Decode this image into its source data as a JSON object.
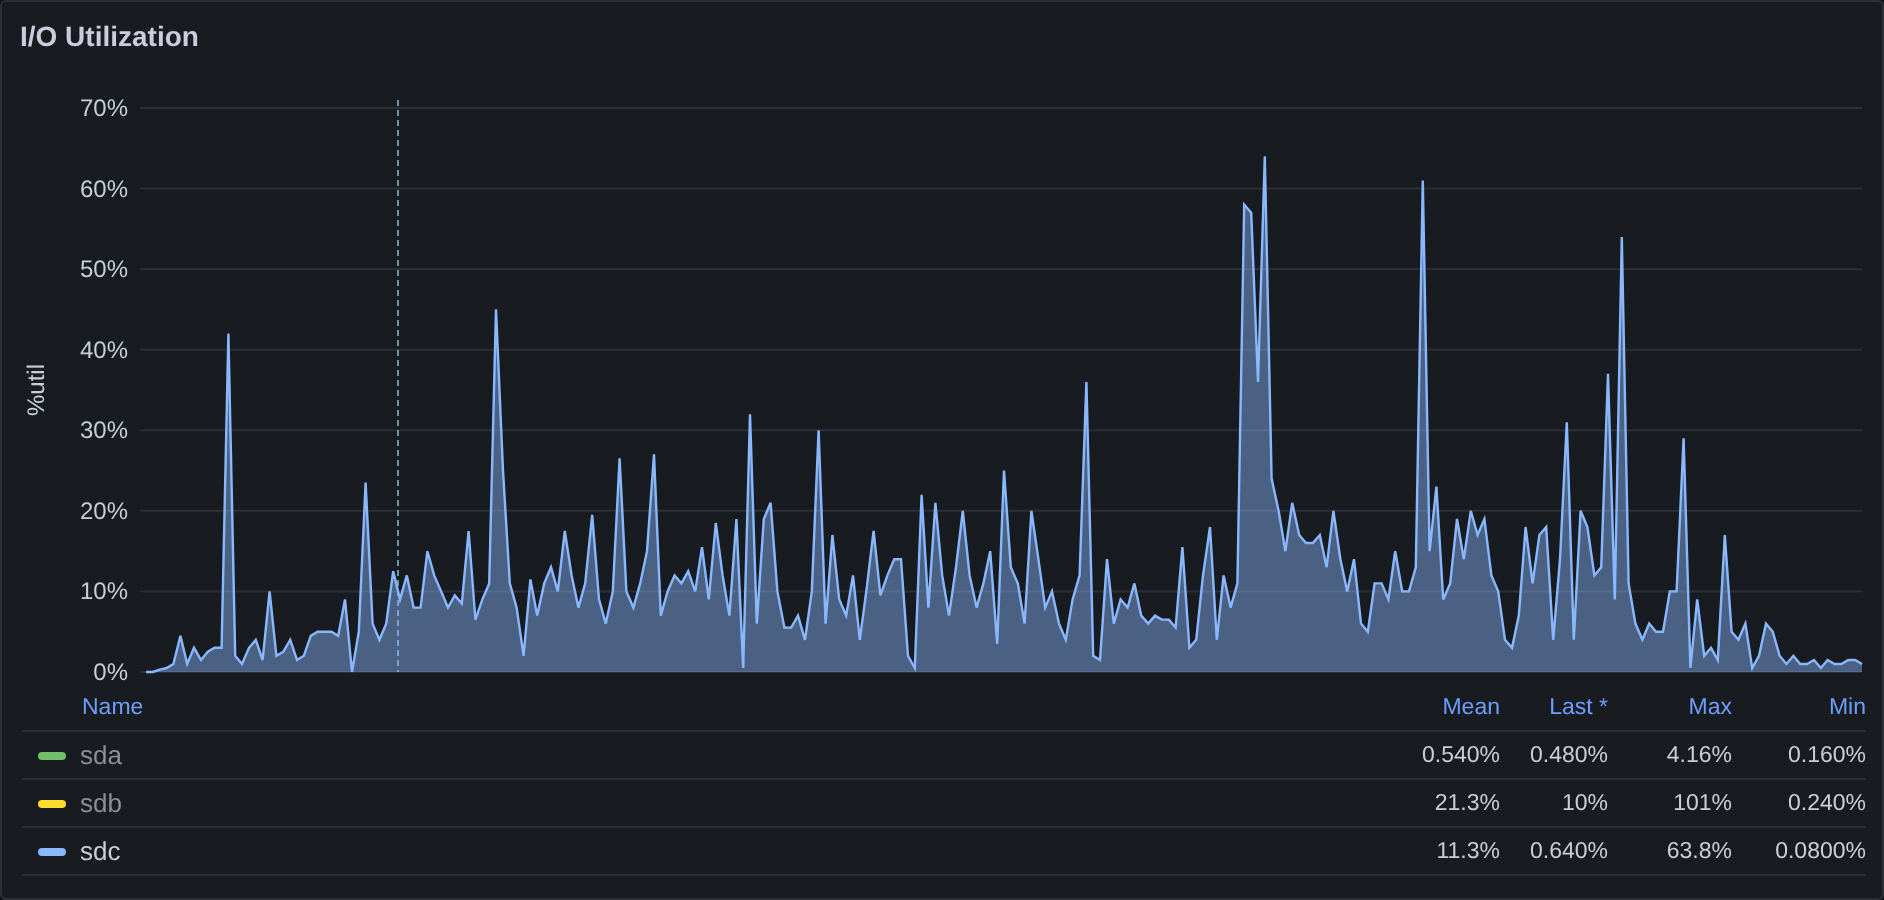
{
  "panel": {
    "title": "I/O Utilization"
  },
  "chart_data": {
    "type": "area",
    "grid": true,
    "ylabel": "%util",
    "ylim": [
      0,
      70
    ],
    "yticks": [
      {
        "value": 0,
        "label": "0%"
      },
      {
        "value": 10,
        "label": "10%"
      },
      {
        "value": 20,
        "label": "20%"
      },
      {
        "value": 30,
        "label": "30%"
      },
      {
        "value": 40,
        "label": "40%"
      },
      {
        "value": 50,
        "label": "50%"
      },
      {
        "value": 60,
        "label": "60%"
      },
      {
        "value": 70,
        "label": "70%"
      }
    ],
    "series": [
      {
        "color": "#8ab8ff",
        "values": [
          0,
          0,
          0.3,
          0.5,
          1,
          4.5,
          1,
          3,
          1.5,
          2.5,
          3,
          3,
          42,
          2,
          1,
          3,
          4,
          1.5,
          10,
          2,
          2.5,
          4,
          1.5,
          2,
          4.5,
          5,
          5,
          5,
          4.5,
          9,
          0,
          5,
          23.5,
          6,
          4,
          6,
          12.5,
          9,
          12,
          8,
          8,
          15,
          12,
          10,
          8,
          9.5,
          8.5,
          17.5,
          6.5,
          9,
          11,
          45,
          25,
          11,
          8,
          2,
          11.5,
          7,
          11,
          13,
          10,
          17.5,
          12,
          8,
          11,
          19.5,
          9,
          6,
          10,
          26.5,
          10,
          8,
          11,
          15,
          27,
          7,
          10,
          12,
          11,
          12.5,
          10,
          15.5,
          9,
          18.5,
          12,
          7,
          19,
          0.5,
          32,
          6,
          19,
          21,
          10,
          5.5,
          5.5,
          7,
          4,
          10,
          30,
          6,
          17,
          9,
          7,
          12,
          4,
          10.5,
          17.5,
          9.5,
          12,
          14,
          14,
          2,
          0.5,
          22,
          8,
          21,
          12,
          7,
          13,
          20,
          12,
          8,
          11,
          15,
          3.5,
          25,
          13,
          11,
          6,
          20,
          14,
          8,
          10,
          6,
          4,
          9,
          12,
          36,
          2,
          1.5,
          14,
          6,
          9,
          8,
          11,
          7,
          6,
          7,
          6.5,
          6.5,
          5.5,
          15.5,
          3,
          4,
          12,
          18,
          4,
          12,
          8,
          11,
          58,
          57,
          36,
          64,
          24,
          20,
          15,
          21,
          17,
          16,
          16,
          17,
          13,
          20,
          14,
          10,
          14,
          6,
          5,
          11,
          11,
          9,
          15,
          10,
          10,
          13,
          61,
          15,
          23,
          9,
          11,
          19,
          14,
          20,
          17,
          19,
          12,
          10,
          4,
          3,
          7,
          18,
          11,
          17,
          18,
          4,
          14,
          31,
          4,
          20,
          18,
          12,
          13,
          37,
          9,
          54,
          11,
          6,
          4,
          6,
          5,
          5,
          10,
          10,
          29,
          0.5,
          9,
          2,
          3,
          1.5,
          17,
          5,
          4,
          6,
          0.5,
          2,
          6,
          5,
          2,
          1,
          2,
          1,
          1,
          1.5,
          0.5,
          1.5,
          1,
          1,
          1.5,
          1.5,
          1
        ]
      }
    ]
  },
  "legend": {
    "columns": [
      "Name",
      "Mean",
      "Last *",
      "Max",
      "Min"
    ],
    "rows": [
      {
        "name": "sda",
        "color": "#73bf69",
        "visible": false,
        "values": [
          "0.540%",
          "0.480%",
          "4.16%",
          "0.160%"
        ]
      },
      {
        "name": "sdb",
        "color": "#fade2a",
        "visible": false,
        "values": [
          "21.3%",
          "10%",
          "101%",
          "0.240%"
        ]
      },
      {
        "name": "sdc",
        "color": "#8ab8ff",
        "visible": true,
        "values": [
          "11.3%",
          "0.640%",
          "63.8%",
          "0.0800%"
        ]
      }
    ]
  }
}
